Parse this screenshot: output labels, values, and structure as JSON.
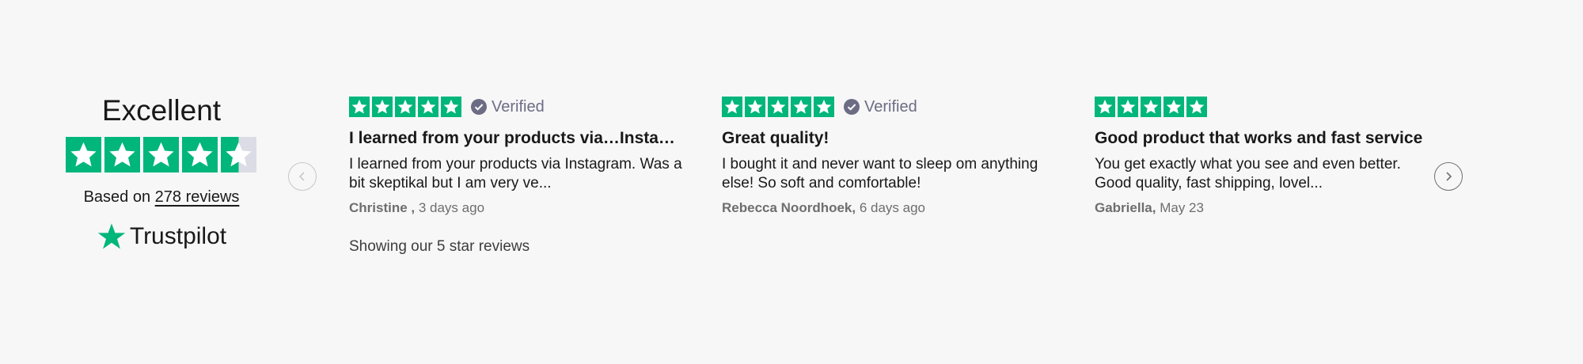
{
  "summary": {
    "title": "Excellent",
    "rating_stars": 4.5,
    "based_on": "Based on ",
    "reviews_link": "278 reviews",
    "brand": "Trustpilot"
  },
  "navigation": {
    "prev_icon": "chevron-left-icon",
    "next_icon": "chevron-right-icon"
  },
  "reviews": [
    {
      "stars": 5,
      "verified": "Verified",
      "title": "I learned from your products via…Insta…",
      "text": "I learned from your products via Instagram. Was a bit skeptikal but I am very ve...",
      "author": "Christine ,",
      "date": " 3 days ago"
    },
    {
      "stars": 5,
      "verified": "Verified",
      "title": "Great quality!",
      "text": "I bought it and never want to sleep om anything else! So soft and comfortable!",
      "author": "Rebecca Noordhoek,",
      "date": " 6 days ago"
    },
    {
      "stars": 5,
      "verified": "",
      "title": "Good product that works and fast service",
      "text": "You get exactly what you see and even better. Good quality, fast shipping, lovel...",
      "author": "Gabriella,",
      "date": " May 23"
    }
  ],
  "footer": {
    "showing": "Showing our 5 star reviews"
  },
  "colors": {
    "star_green": "#00b67a",
    "star_empty": "#dcdce6",
    "verified_gray": "#6c6c85",
    "background": "#f7f7f7"
  }
}
